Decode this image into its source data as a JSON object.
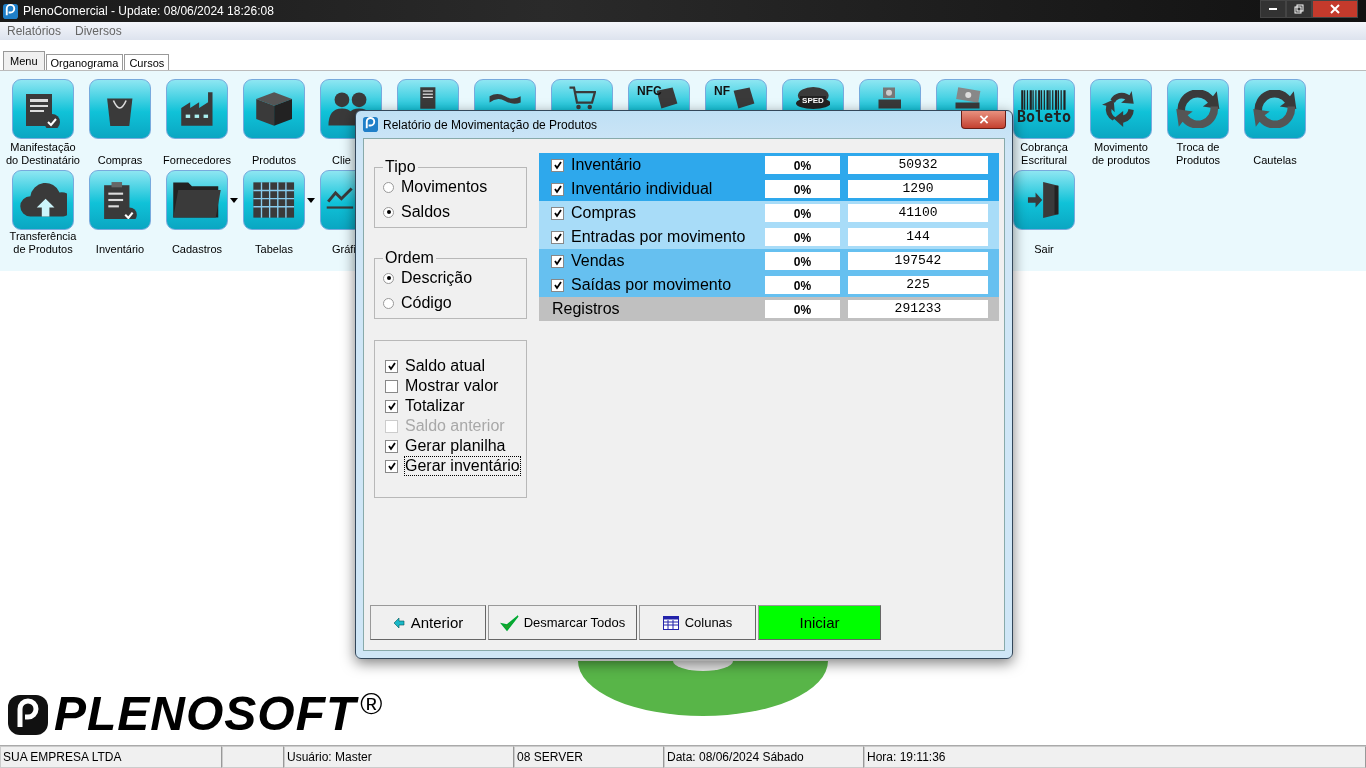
{
  "window": {
    "title": "PlenoComercial - Update: 08/06/2024 18:26:08"
  },
  "menu": [
    "Relatórios",
    "Diversos"
  ],
  "tabs": [
    {
      "label": "Menu",
      "selected": true
    },
    {
      "label": "Organograma",
      "selected": false
    },
    {
      "label": "Cursos",
      "selected": false
    }
  ],
  "toolbar_rows": [
    [
      {
        "label": "Manifestação\ndo Destinatário",
        "dropdown": false
      },
      {
        "label": "Compras",
        "dropdown": false
      },
      {
        "label": "Fornecedores",
        "dropdown": false
      },
      {
        "label": "Produtos",
        "dropdown": false
      },
      {
        "label": "Clie",
        "dropdown": false
      },
      {
        "dropdown": false
      },
      {
        "dropdown": false
      },
      {
        "dropdown": false
      },
      {
        "icon_text": "NFC",
        "dropdown": false
      },
      {
        "icon_text": "NF",
        "dropdown": false
      },
      {
        "icon_text": "SPED",
        "dropdown": false
      },
      {
        "dropdown": false
      },
      {
        "dropdown": false
      },
      {
        "icon_text": "Boleto",
        "label": "Cobrança\nEscritural",
        "dropdown": false
      },
      {
        "label": "Movimento\nde produtos",
        "dropdown": false
      },
      {
        "label": "Troca de\nProdutos",
        "dropdown": false
      },
      {
        "label": "Cautelas",
        "dropdown": false
      }
    ],
    [
      {
        "label": "Transferência\nde Produtos",
        "dropdown": false
      },
      {
        "label": "Inventário",
        "dropdown": false
      },
      {
        "label": "Cadastros",
        "dropdown": true
      },
      {
        "label": "Tabelas",
        "dropdown": true
      },
      {
        "label": "Gráfi",
        "dropdown": false
      },
      {
        "label": "Sair",
        "dropdown": false
      }
    ]
  ],
  "dialog": {
    "title": "Relatório de Movimentação de Produtos",
    "groups": [
      {
        "legend": "Tipo",
        "options": [
          {
            "label": "Movimentos",
            "selected": false
          },
          {
            "label": "Saldos",
            "selected": true
          }
        ]
      },
      {
        "legend": "Ordem",
        "options": [
          {
            "label": "Descrição",
            "selected": true
          },
          {
            "label": "Código",
            "selected": false
          }
        ]
      }
    ],
    "options": [
      {
        "label": "Saldo atual",
        "checked": true,
        "disabled": false,
        "focused": false
      },
      {
        "label": "Mostrar valor",
        "checked": false,
        "disabled": false,
        "focused": false
      },
      {
        "label": "Totalizar",
        "checked": true,
        "disabled": false,
        "focused": false
      },
      {
        "label": "Saldo anterior",
        "checked": false,
        "disabled": true,
        "focused": false
      },
      {
        "label": "Gerar planilha",
        "checked": true,
        "disabled": false,
        "focused": false
      },
      {
        "label": "Gerar inventário",
        "checked": true,
        "disabled": false,
        "focused": true
      }
    ],
    "sources": [
      {
        "kind": "source",
        "label": "Inventário",
        "checked": true,
        "percent": "0%",
        "count": "50932",
        "color": "#2ea8ec"
      },
      {
        "kind": "source",
        "label": "Inventário individual",
        "checked": true,
        "percent": "0%",
        "count": "1290",
        "color": "#2ea8ec"
      },
      {
        "kind": "source",
        "label": "Compras",
        "checked": true,
        "percent": "0%",
        "count": "41100",
        "color": "#a8dcf8"
      },
      {
        "kind": "source",
        "label": "Entradas por movimento",
        "checked": true,
        "percent": "0%",
        "count": "144",
        "color": "#a8dcf8"
      },
      {
        "kind": "source",
        "label": "Vendas",
        "checked": true,
        "percent": "0%",
        "count": "197542",
        "color": "#66c0f0"
      },
      {
        "kind": "source",
        "label": "Saídas por movimento",
        "checked": true,
        "percent": "0%",
        "count": "225",
        "color": "#66c0f0"
      },
      {
        "kind": "total",
        "label": "Registros",
        "percent": "0%",
        "count": "291233",
        "color": "#c0c0c0"
      }
    ],
    "buttons": [
      {
        "kind": "back",
        "label": "Anterior"
      },
      {
        "kind": "uncheck",
        "label": "Desmarcar Todos"
      },
      {
        "kind": "columns",
        "label": "Colunas"
      },
      {
        "kind": "primary",
        "label": "Iniciar"
      }
    ]
  },
  "logo": {
    "text": "PLENOSOFT",
    "mark": "®"
  },
  "status_bar": [
    "SUA EMPRESA LTDA",
    "Usuário: Master",
    "08 SERVER",
    "Data: 08/06/2024 Sábado",
    "Hora: 19:11:36"
  ]
}
